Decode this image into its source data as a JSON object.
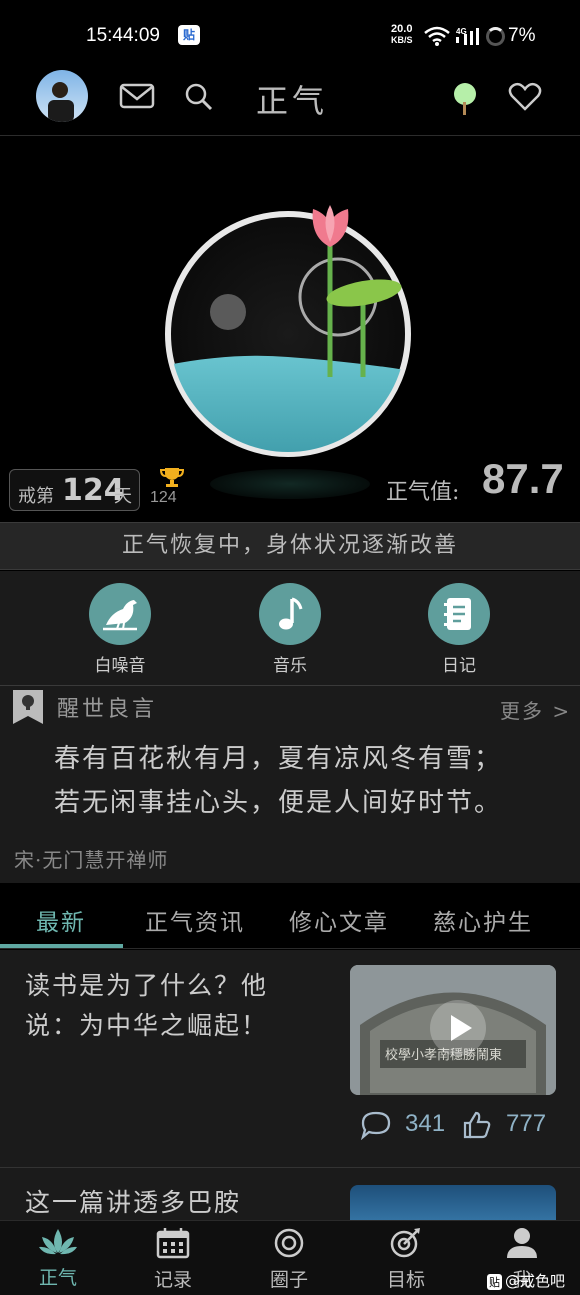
{
  "status_bar": {
    "time": "15:44:09",
    "app_badge": "贴",
    "net_speed": "20.0",
    "net_unit": "KB/S",
    "battery": "7%"
  },
  "header": {
    "title": "正气",
    "icons": [
      "avatar",
      "mail-icon",
      "search-icon",
      "tree-icon",
      "heart-icon"
    ]
  },
  "hero": {
    "streak_prefix": "戒第",
    "streak_days": "124",
    "streak_suffix": "天",
    "trophy_count": "124",
    "zhengqi_label": "正气值:",
    "zhengqi_value": "87.7"
  },
  "status_banner": "正气恢复中，身体状况逐渐改善",
  "quick_actions": [
    {
      "label": "白噪音",
      "icon": "bird-icon"
    },
    {
      "label": "音乐",
      "icon": "music-note-icon"
    },
    {
      "label": "日记",
      "icon": "notebook-icon"
    }
  ],
  "quote": {
    "title": "醒世良言",
    "more": "更多 >",
    "lines": [
      "春有百花秋有月，夏有凉风冬有雪；",
      "若无闲事挂心头，便是人间好时节。"
    ],
    "author": "宋·无门慧开禅师"
  },
  "tabs": [
    {
      "label": "最新",
      "active": true
    },
    {
      "label": "正气资讯",
      "active": false
    },
    {
      "label": "修心文章",
      "active": false
    },
    {
      "label": "慈心护生",
      "active": false
    }
  ],
  "feed": [
    {
      "title": "读书是为了什么？他说：为中华之崛起！",
      "comments": "341",
      "likes": "777"
    },
    {
      "title": "这一篇讲透多巴胺"
    }
  ],
  "bottom_nav": [
    {
      "label": "正气",
      "icon": "lotus-icon",
      "active": true
    },
    {
      "label": "记录",
      "icon": "calendar-icon",
      "active": false
    },
    {
      "label": "圈子",
      "icon": "circle-target-icon",
      "active": false
    },
    {
      "label": "目标",
      "icon": "goal-icon",
      "active": false
    },
    {
      "label": "我",
      "icon": "person-icon",
      "active": false
    }
  ],
  "watermark": {
    "badge": "贴",
    "text": "@戒色吧"
  },
  "colors": {
    "accent": "#6fb7b0",
    "icon_circle": "#5f9e9c",
    "water": "#5bb3c0",
    "lotus": "#f07a8e"
  }
}
